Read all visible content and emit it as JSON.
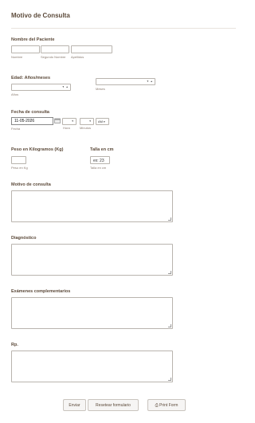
{
  "form": {
    "title": "Motivo de Consulta",
    "patient_name": {
      "label": "Nombre del Paciente",
      "sub": [
        "Nombre",
        "Segundo Nombre",
        "Apellidos"
      ]
    },
    "age": {
      "label": "Edad: Años/meses",
      "years_sub": "Años",
      "months_sub": "Meses",
      "spinner": "▾ ▴"
    },
    "date": {
      "label": "Fecha de consulta",
      "value": "11-05-2026",
      "date_sub": "Fecha",
      "hour_sub": "Hora",
      "minute_sub": "Minutos",
      "ampm": "AM"
    },
    "weight": {
      "label": "Peso en Kilogramos (Kg)",
      "sub": "Peso en Kg"
    },
    "height": {
      "label": "Talla en cm",
      "placeholder": "ex: 23",
      "sub": "Talla en cm"
    },
    "reason": {
      "label": "Motivo de consulta"
    },
    "diagnosis": {
      "label": "Diagnóstico"
    },
    "exams": {
      "label": "Exámenes complementarios"
    },
    "rp": {
      "label": "Rp."
    }
  },
  "buttons": {
    "submit": "Enviar",
    "reset": "Resetear formulario",
    "print": "Print Form"
  }
}
